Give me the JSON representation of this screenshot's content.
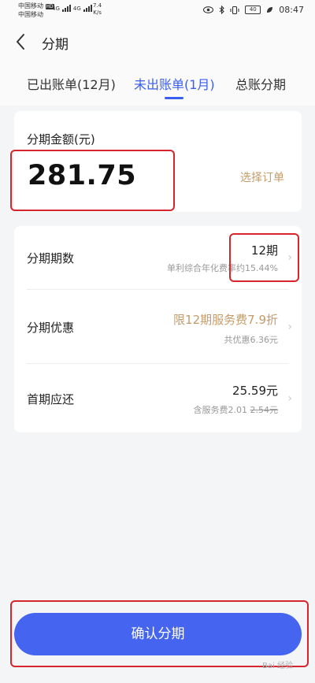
{
  "status_bar": {
    "carrier1": "中国移动",
    "carrier2": "中国移动",
    "hd": "HD",
    "net1": "4G",
    "net2": "4G",
    "speed_value": "7.4",
    "speed_unit": "K/s",
    "battery": "40",
    "time": "08:47"
  },
  "header": {
    "title": "分期"
  },
  "tabs": [
    {
      "label": "已出账单(12月)"
    },
    {
      "label": "未出账单(1月)",
      "active": true
    },
    {
      "label": "总账分期"
    }
  ],
  "amount_card": {
    "label": "分期金额(元)",
    "value": "281.75",
    "select_order": "选择订单"
  },
  "rows": [
    {
      "label": "分期期数",
      "main": "12期",
      "sub": "单利综合年化费率约15.44%"
    },
    {
      "label": "分期优惠",
      "main": "限12期服务费7.9折",
      "sub": "共优惠6.36元"
    },
    {
      "label": "首期应还",
      "main": "25.59元",
      "sub": "含服务费2.01",
      "sub_strike": "2.54元"
    }
  ],
  "confirm": {
    "label": "确认分期"
  },
  "watermark": "Bai 经验",
  "colors": {
    "accent": "#4564ef",
    "gold": "#c49b6a",
    "highlight_box": "#d6252c"
  }
}
